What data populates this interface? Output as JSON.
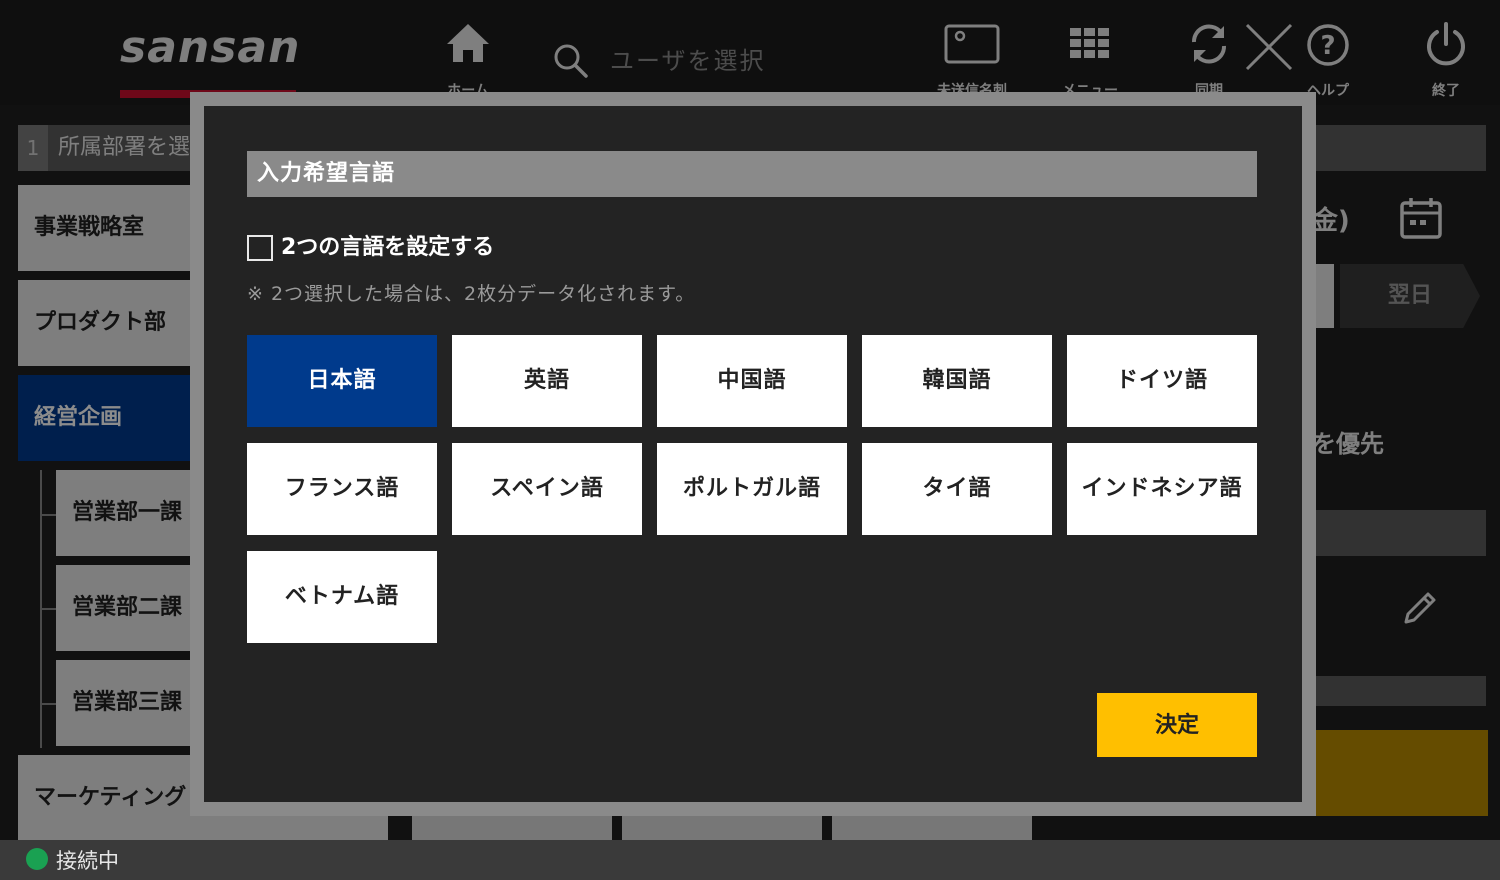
{
  "header": {
    "logo": "sansan",
    "home_label": "ホーム",
    "search_placeholder": "ユーザを選択",
    "unsent_label": "未送信名刺",
    "menu_label": "メニュー",
    "sync_label": "同期",
    "help_label": "ヘルプ",
    "exit_label": "終了"
  },
  "left_panel": {
    "step_number": "1",
    "step_label": "所属部署を選択",
    "departments": [
      "事業戦略室",
      "プロダクト部",
      "経営企画",
      "営業部一課",
      "営業部二課",
      "営業部三課",
      "マーケティング"
    ]
  },
  "right_panel": {
    "date_suffix": "(金)",
    "next_day": "翌日",
    "priority_text": "を優先"
  },
  "status": {
    "label": "接続中",
    "color": "#1aa152"
  },
  "modal": {
    "title": "入力希望言語",
    "checkbox_label": "2つの言語を設定する",
    "note": "※ 2つ選択した場合は、2枚分データ化されます。",
    "languages": [
      "日本語",
      "英語",
      "中国語",
      "韓国語",
      "ドイツ語",
      "フランス語",
      "スペイン語",
      "ポルトガル語",
      "タイ語",
      "インドネシア語",
      "ベトナム語"
    ],
    "selected_language": "日本語",
    "confirm_label": "決定"
  },
  "colors": {
    "accent_blue": "#003a8c",
    "confirm_yellow": "#ffbf00",
    "brand_red": "#c8102e"
  }
}
